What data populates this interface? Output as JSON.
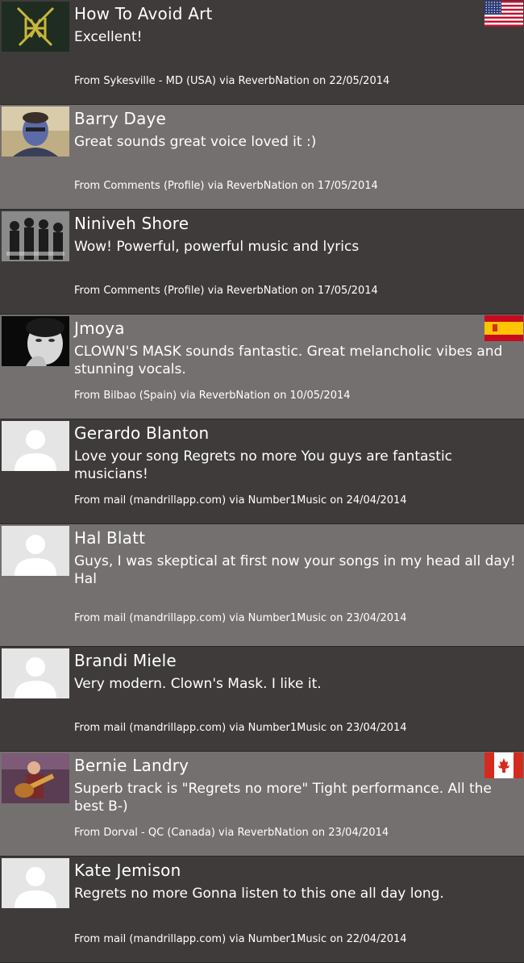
{
  "comments": [
    {
      "name": "How To Avoid Art",
      "message": "Excellent!",
      "meta": "From Sykesville - MD (USA) via ReverbNation on 22/05/2014",
      "avatar": "band-logo-avatar",
      "flag": "us"
    },
    {
      "name": "Barry Daye",
      "message": "Great sounds great voice loved it :)",
      "meta": "From Comments (Profile) via ReverbNation on 17/05/2014",
      "avatar": "photo-avatar",
      "flag": ""
    },
    {
      "name": "Niniveh Shore",
      "message": "Wow! Powerful, powerful music and lyrics",
      "meta": "From Comments (Profile) via ReverbNation on 17/05/2014",
      "avatar": "band-photo-avatar",
      "flag": ""
    },
    {
      "name": "Jmoya",
      "message": "CLOWN'S MASK sounds fantastic. Great melancholic vibes and stunning vocals.",
      "meta": "From Bilbao (Spain) via ReverbNation on 10/05/2014",
      "avatar": "bw-portrait-avatar",
      "flag": "es"
    },
    {
      "name": "Gerardo Blanton",
      "message": "Love your song Regrets no more You guys are fantastic musicians!",
      "meta": "From mail (mandrillapp.com) via Number1Music on 24/04/2014",
      "avatar": "default-avatar",
      "flag": ""
    },
    {
      "name": "Hal Blatt",
      "message": "Guys, I was skeptical at first now your songs in my head all day!\nHal",
      "meta": "From mail (mandrillapp.com) via Number1Music on 23/04/2014",
      "avatar": "default-avatar",
      "flag": ""
    },
    {
      "name": "Brandi Miele",
      "message": "Very modern. Clown's Mask. I like it.",
      "meta": "From mail (mandrillapp.com) via Number1Music on 23/04/2014",
      "avatar": "default-avatar",
      "flag": ""
    },
    {
      "name": "Bernie Landry",
      "message": "Superb track is \"Regrets no more\" Tight performance. All the best B-)",
      "meta": "From Dorval - QC (Canada) via ReverbNation on 23/04/2014",
      "avatar": "guitarist-photo-avatar",
      "flag": "ca"
    },
    {
      "name": "Kate Jemison",
      "message": "Regrets no more Gonna listen to this one all day long.",
      "meta": "From mail (mandrillapp.com) via Number1Music on 22/04/2014",
      "avatar": "default-avatar",
      "flag": ""
    }
  ]
}
